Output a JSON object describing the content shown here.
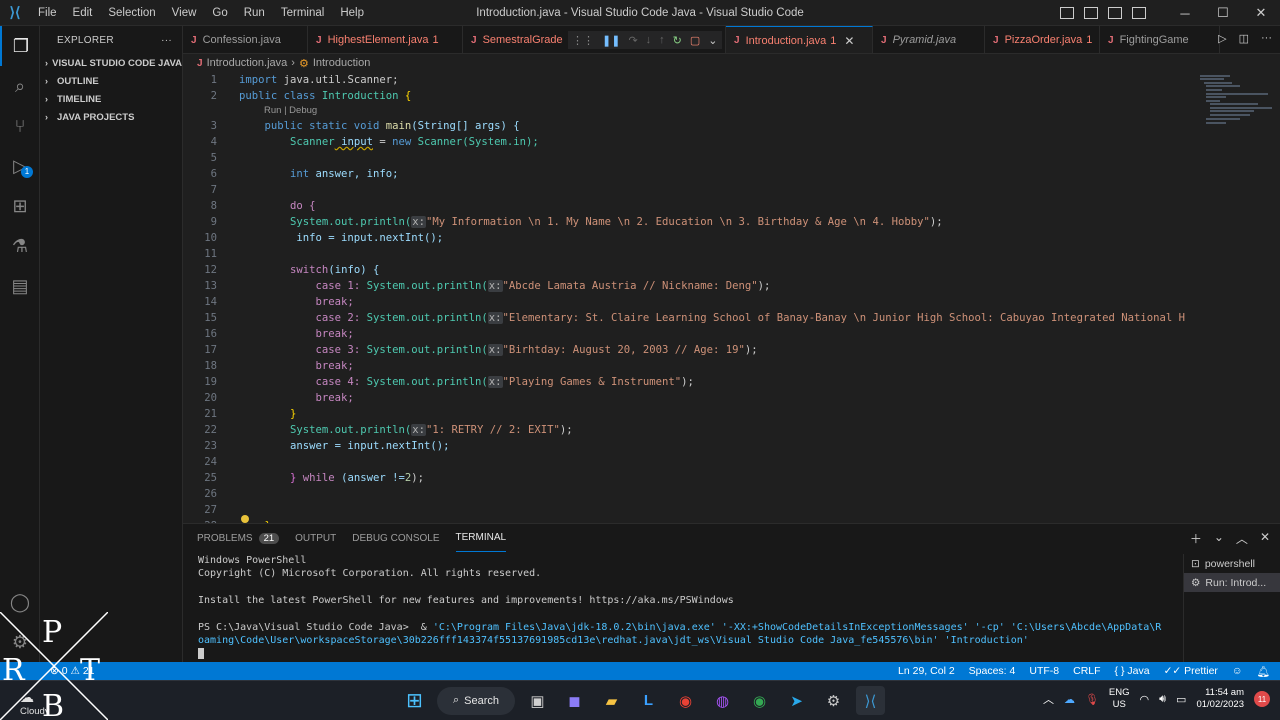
{
  "app": {
    "title": "Introduction.java - Visual Studio Code Java - Visual Studio Code",
    "menu": [
      "File",
      "Edit",
      "Selection",
      "View",
      "Go",
      "Run",
      "Terminal",
      "Help"
    ]
  },
  "sidebar": {
    "header": "EXPLORER",
    "more": "···",
    "sections": [
      "VISUAL STUDIO CODE JAVA",
      "OUTLINE",
      "TIMELINE",
      "JAVA PROJECTS"
    ]
  },
  "activity": {
    "debug_badge": "1"
  },
  "tabs": [
    {
      "label": "Confession.java",
      "badge": "",
      "italic": false,
      "error": false
    },
    {
      "label": "HighestElement.java",
      "badge": "1",
      "italic": false,
      "error": true
    },
    {
      "label": "SemestralGrade",
      "badge": "",
      "italic": false,
      "error": true
    },
    {
      "label": "Introduction.java",
      "badge": "1",
      "italic": false,
      "error": true,
      "active": true
    },
    {
      "label": "Pyramid.java",
      "badge": "",
      "italic": true,
      "error": false
    },
    {
      "label": "PizzaOrder.java",
      "badge": "1",
      "italic": false,
      "error": true
    },
    {
      "label": "FightingGame",
      "badge": "",
      "italic": false,
      "error": false
    }
  ],
  "breadcrumb": [
    "Introduction.java",
    "Introduction"
  ],
  "editor": {
    "codelens": "Run | Debug",
    "lines": [
      "1",
      "2",
      "3",
      "4",
      "5",
      "6",
      "7",
      "8",
      "9",
      "10",
      "11",
      "12",
      "13",
      "14",
      "15",
      "16",
      "17",
      "18",
      "19",
      "20",
      "21",
      "22",
      "23",
      "24",
      "25",
      "26",
      "27",
      "28"
    ],
    "code": {
      "l1_import": "import",
      "l1_pkg": " java.util.Scanner;",
      "l2_a": "public class",
      "l2_b": " Introduction ",
      "l2_c": "{",
      "l3_a": "public static void",
      "l3_b": "main",
      "l3_c": "(String[] args) {",
      "l4_a": "Scanner",
      "l4_b": " input",
      "l4_c": " = ",
      "l4_d": "new",
      "l4_e": " Scanner(System.in);",
      "l6_a": "int",
      "l6_b": " answer, info;",
      "l8": "do {",
      "println": "System.out.println(",
      "hint": "x:",
      "l9_str": "\"My Information \\n 1. My Name \\n 2. Education \\n 3. Birthday & Age \\n 4. Hobby\"",
      "end": ");",
      "l10": "info = input.nextInt();",
      "l12_a": "switch",
      "l12_b": "(info) {",
      "case1": "case 1:",
      "l13_str": "\"Abcde Lamata Austria // Nickname: Deng\"",
      "break": "break;",
      "case2": "case 2:",
      "l15_str": "\"Elementary: St. Claire Learning School of Banay-Banay \\n Junior High School: Cabuyao Integrated National H",
      "case3": "case 3:",
      "l17_str": "\"Birhtday: August 20, 2003 // Age: 19\"",
      "case4": "case 4:",
      "l19_str": "\"Playing Games & Instrument\"",
      "l21": "}",
      "l22_str": "\"1: RETRY // 2: EXIT\"",
      "l23": "answer = input.nextInt();",
      "l25_a": "} ",
      "l25_b": "while",
      "l25_c": " (answer !=",
      "l25_d": "2",
      "l25_e": ");",
      "l28": "}"
    }
  },
  "panel": {
    "tabs": [
      {
        "label": "PROBLEMS",
        "count": "21"
      },
      {
        "label": "OUTPUT",
        "count": ""
      },
      {
        "label": "DEBUG CONSOLE",
        "count": ""
      },
      {
        "label": "TERMINAL",
        "count": "",
        "active": true
      }
    ],
    "terminal": {
      "l1": "Windows PowerShell",
      "l2": "Copyright (C) Microsoft Corporation. All rights reserved.",
      "l3": "Install the latest PowerShell for new features and improvements! https://aka.ms/PSWindows",
      "prompt": "PS C:\\Java\\Visual Studio Code Java> ",
      "amp": " & ",
      "cmd1": "'C:\\Program Files\\Java\\jdk-18.0.2\\bin\\java.exe' '-XX:+ShowCodeDetailsInExceptionMessages' '-cp' 'C:\\Users\\Abcde\\AppData\\R",
      "cmd2": "oaming\\Code\\User\\workspaceStorage\\30b226fff143374f55137691985cd13e\\redhat.java\\jdt_ws\\Visual Studio Code Java_fe545576\\bin' 'Introduction'"
    },
    "terminals": [
      "powershell",
      "Run: Introd..."
    ]
  },
  "status": {
    "errors": "0",
    "warnings": "21",
    "position": "Ln 29, Col 2",
    "spaces": "Spaces: 4",
    "encoding": "UTF-8",
    "eol": "CRLF",
    "language": "{ } Java",
    "prettier": "Prettier"
  },
  "taskbar": {
    "weather": "Cloudy",
    "search": "Search",
    "lang_top": "ENG",
    "lang_bottom": "US",
    "time": "11:54 am",
    "date": "01/02/2023",
    "notifications": "11"
  },
  "watermark": [
    "P",
    "R",
    "T",
    "B"
  ]
}
